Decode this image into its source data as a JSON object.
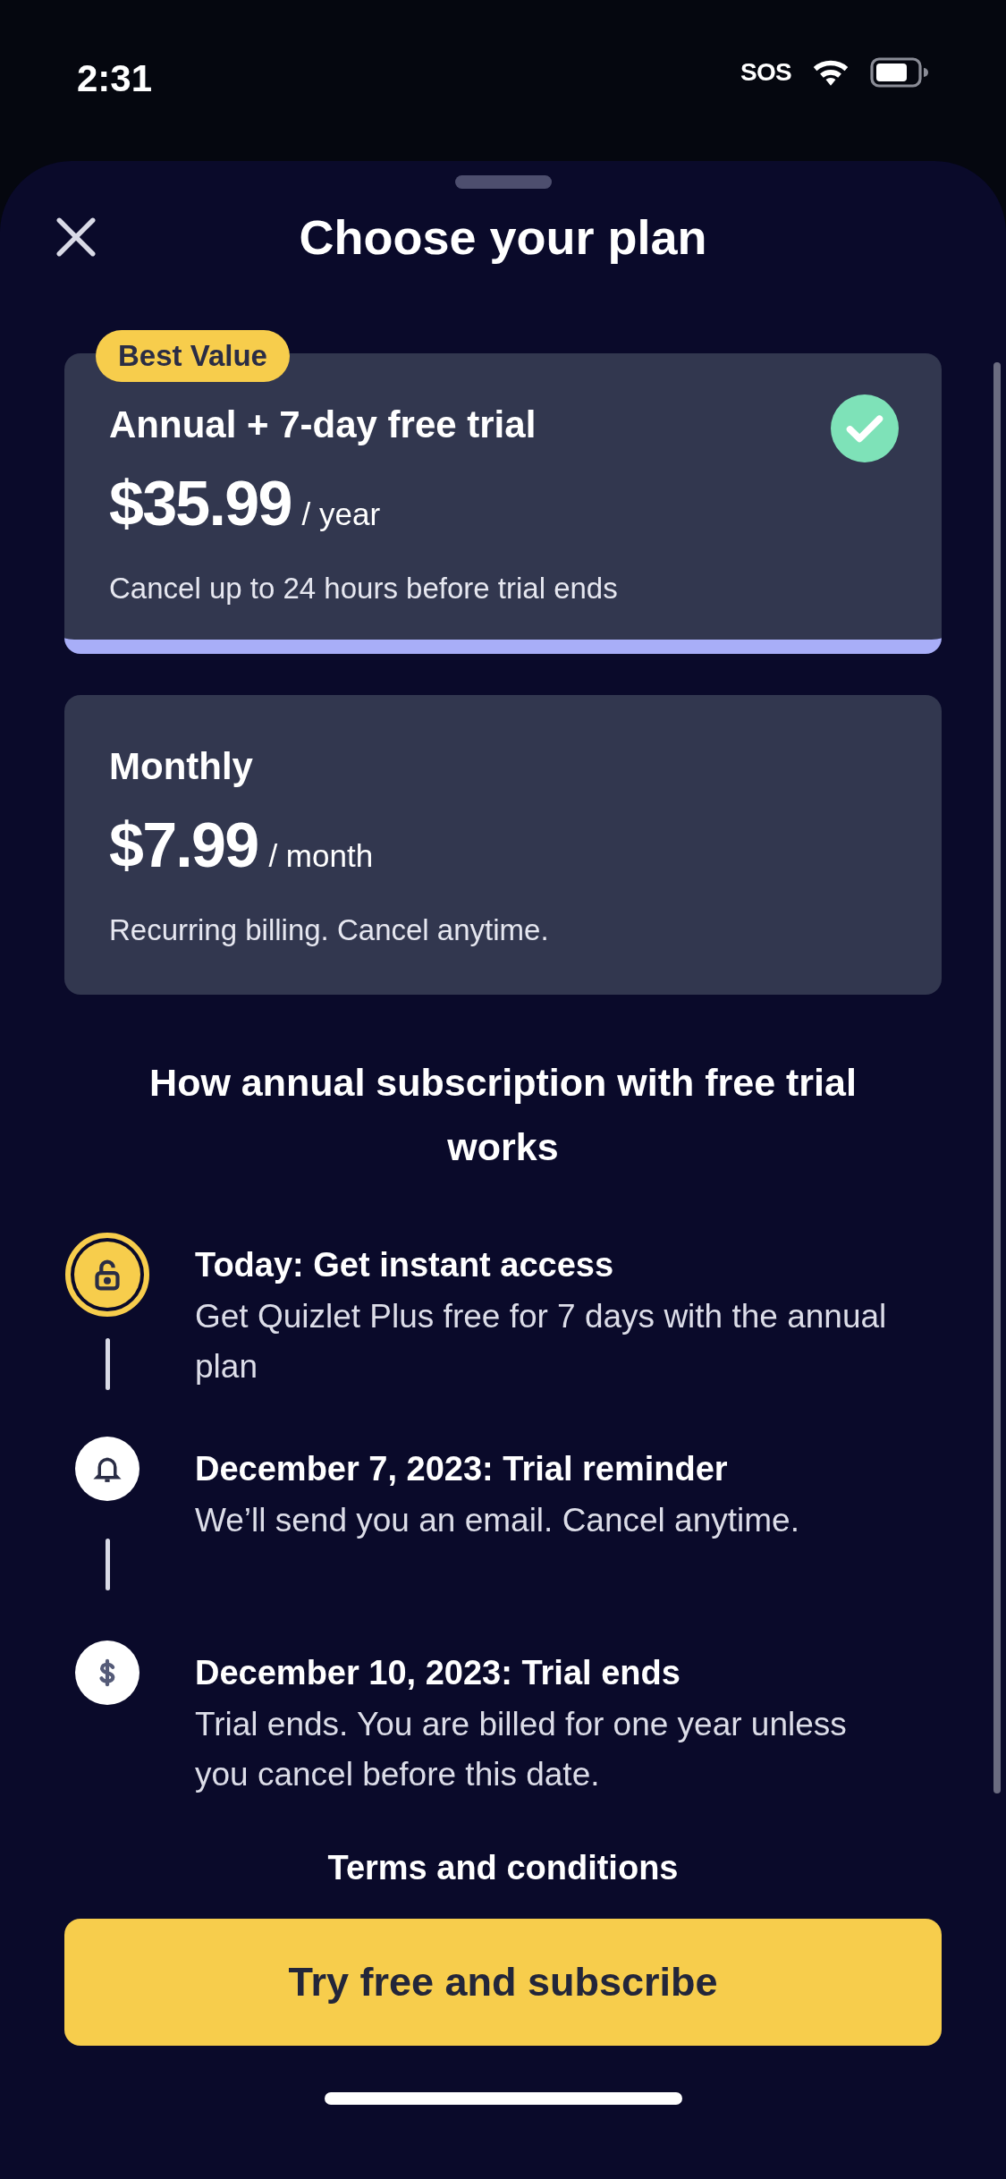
{
  "status_bar": {
    "time": "2:31",
    "sos": "SOS"
  },
  "sheet": {
    "title": "Choose your plan"
  },
  "plans": [
    {
      "badge": "Best Value",
      "name": "Annual + 7-day free trial",
      "price": "$35.99",
      "period": "/ year",
      "note": "Cancel up to 24 hours before trial ends",
      "selected": true
    },
    {
      "name": "Monthly",
      "price": "$7.99",
      "period": "/ month",
      "note": "Recurring billing. Cancel anytime.",
      "selected": false
    }
  ],
  "how_it_works": {
    "title": "How annual subscription with free trial works",
    "steps": [
      {
        "kind": "lock",
        "active": true,
        "title": "Today: Get instant access",
        "text": "Get Quizlet Plus free for 7 days with the annual plan"
      },
      {
        "kind": "bell",
        "active": false,
        "title": "December 7, 2023: Trial reminder",
        "text": "We’ll send you an email. Cancel anytime."
      },
      {
        "kind": "dollar",
        "active": false,
        "title": "December 10, 2023: Trial ends",
        "text": "Trial ends. You are billed for one year unless you cancel before this date."
      }
    ]
  },
  "terms_link": "Terms and conditions",
  "cta_button": "Try free and subscribe"
}
